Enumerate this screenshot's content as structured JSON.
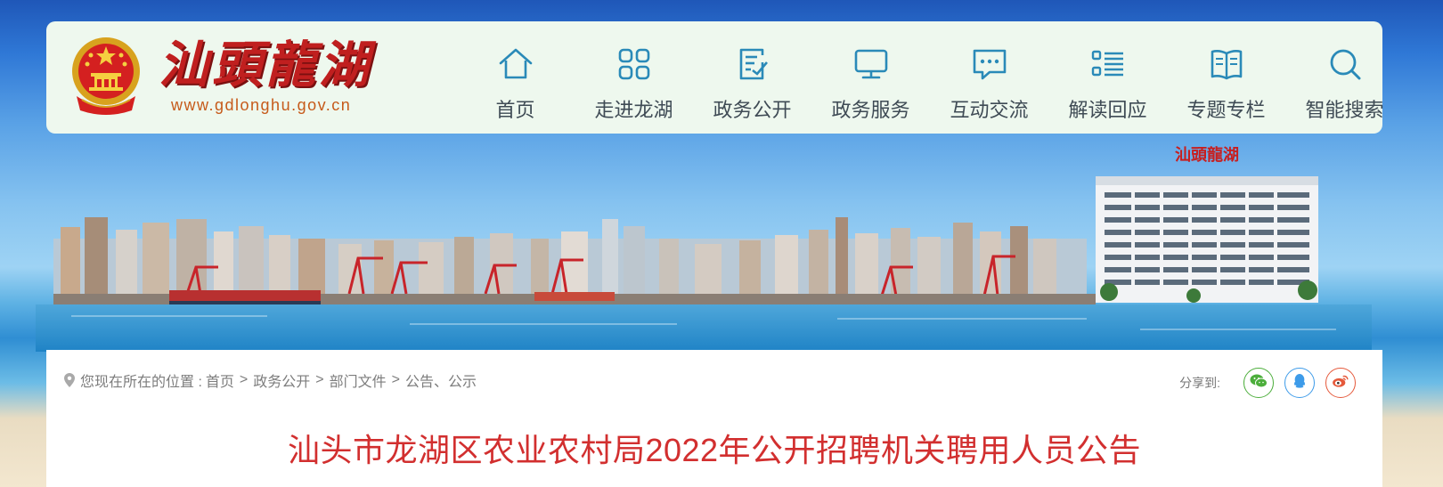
{
  "site": {
    "brand_title": "汕頭龍湖",
    "url": "www.gdlonghu.gov.cn"
  },
  "nav": {
    "items": [
      {
        "label": "首页",
        "icon": "home-icon"
      },
      {
        "label": "走进龙湖",
        "icon": "grid-icon"
      },
      {
        "label": "政务公开",
        "icon": "document-edit-icon"
      },
      {
        "label": "政务服务",
        "icon": "monitor-icon"
      },
      {
        "label": "互动交流",
        "icon": "chat-icon"
      },
      {
        "label": "解读回应",
        "icon": "list-icon"
      },
      {
        "label": "专题专栏",
        "icon": "book-icon"
      },
      {
        "label": "智能搜索",
        "icon": "search-icon"
      }
    ]
  },
  "banner": {
    "building_sign": "汕頭龍湖"
  },
  "breadcrumb": {
    "prefix": "您现在所在的位置 :",
    "items": [
      "首页",
      "政务公开",
      "部门文件",
      "公告、公示"
    ],
    "separator": ">"
  },
  "share": {
    "label": "分享到:",
    "buttons": [
      "wechat-icon",
      "qq-icon",
      "weibo-icon"
    ]
  },
  "article": {
    "title": "汕头市龙湖区农业农村局2022年公开招聘机关聘用人员公告"
  },
  "colors": {
    "nav_icon": "#2a8ab8",
    "title_red": "#d22f2f",
    "header_bg": "#eef8ee"
  }
}
